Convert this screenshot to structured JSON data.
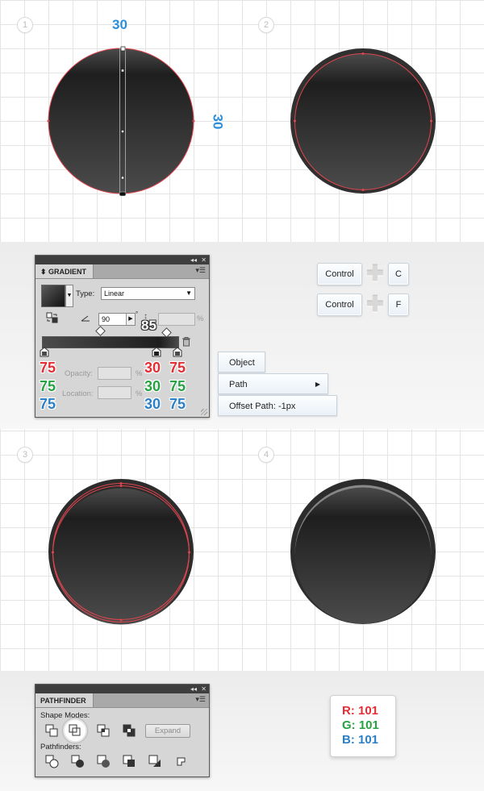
{
  "steps": {
    "s1": "1",
    "s2": "2",
    "s3": "3",
    "s4": "4"
  },
  "dimensions": {
    "width": "30",
    "height": "30"
  },
  "gradient_panel": {
    "tab": "GRADIENT",
    "type_label": "Type:",
    "type_value": "Linear",
    "angle": "90",
    "aspect_unit": "%",
    "aspect_big": "85",
    "opacity_label": "Opacity:",
    "location_label": "Location:",
    "pct": "%"
  },
  "color_values": {
    "left": {
      "r": "75",
      "g": "75",
      "b": "75"
    },
    "mid": {
      "r": "30",
      "g": "30",
      "b": "30"
    },
    "right": {
      "r": "75",
      "g": "75",
      "b": "75"
    }
  },
  "shortcuts": {
    "copy": {
      "mod": "Control",
      "key": "C"
    },
    "paste": {
      "mod": "Control",
      "key": "F"
    }
  },
  "menu": {
    "object": "Object",
    "path": "Path",
    "offset": "Offset Path: -1px"
  },
  "pathfinder_panel": {
    "tab": "PATHFINDER",
    "shape_modes": "Shape Modes:",
    "pathfinders": "Pathfinders:",
    "expand": "Expand"
  },
  "rgb": {
    "r": "R: 101",
    "g": "G: 101",
    "b": "B: 101",
    "colors": {
      "r": "#e42d34",
      "g": "#27a243",
      "b": "#2a80c8"
    }
  },
  "icons": [
    "collapse-icon",
    "close-icon",
    "panel-menu-icon",
    "swatch-arrow-icon",
    "dropdown-icon",
    "reverse-gradient-icon",
    "angle-icon",
    "aspect-ratio-icon",
    "color-stop-icon",
    "midpoint-icon",
    "trash-icon",
    "submenu-arrow-icon",
    "plus-icon",
    "unite-icon",
    "minus-front-icon",
    "intersect-icon",
    "exclude-icon",
    "divide-icon",
    "trim-icon",
    "merge-icon",
    "crop-icon",
    "outline-icon",
    "minus-back-icon"
  ]
}
